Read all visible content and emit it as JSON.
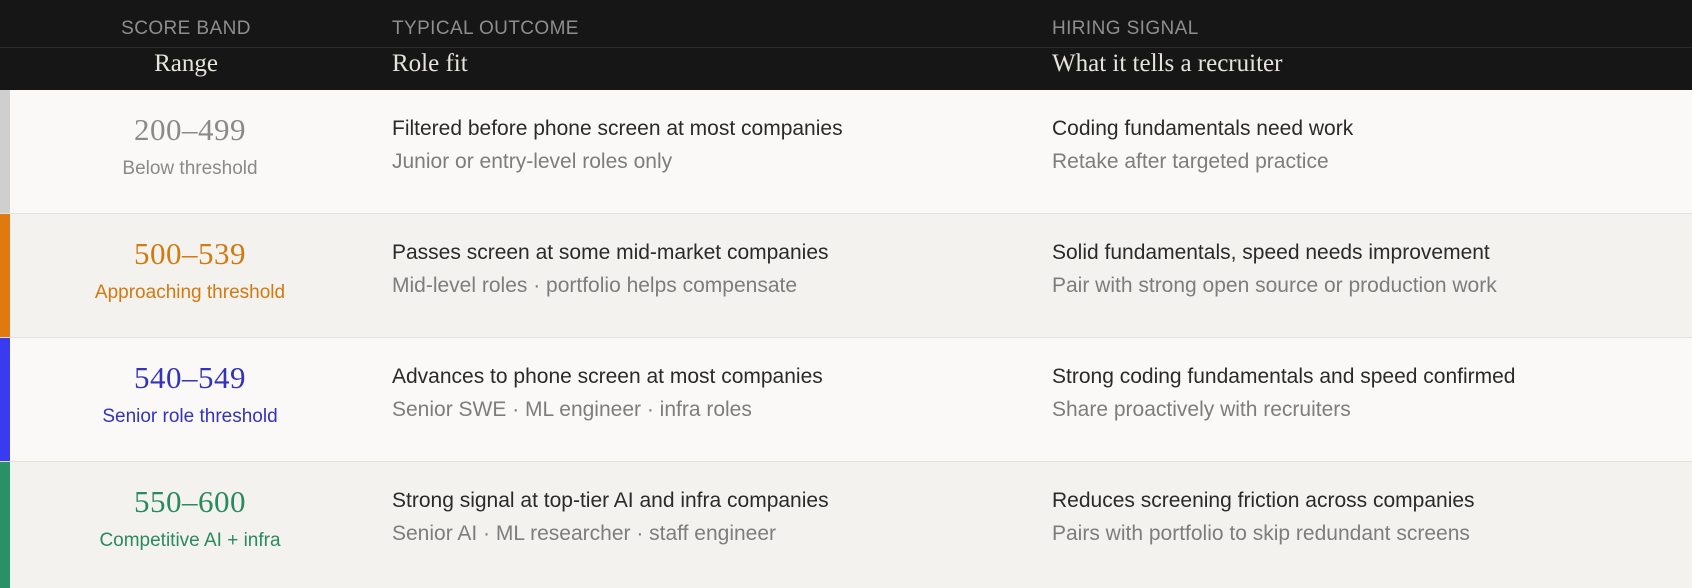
{
  "header": {
    "range": {
      "eyebrow": "SCORE BAND",
      "title": "Range"
    },
    "outcome": {
      "eyebrow": "TYPICAL OUTCOME",
      "title": "Role fit"
    },
    "signal": {
      "eyebrow": "HIRING SIGNAL",
      "title": "What it tells a recruiter"
    }
  },
  "rows": [
    {
      "range": "200–499",
      "band": "Below threshold",
      "color": "#8a8a8a",
      "accent": "#cfcfcf",
      "outcome_primary": "Filtered before phone screen at most companies",
      "outcome_secondary": "Junior or entry-level roles only",
      "signal_primary": "Coding fundamentals need work",
      "signal_secondary": "Retake after targeted practice"
    },
    {
      "range": "500–539",
      "band": "Approaching threshold",
      "color": "#d07a10",
      "accent": "#e07a10",
      "outcome_primary": "Passes screen at some mid-market companies",
      "outcome_secondary": "Mid-level roles · portfolio helps compensate",
      "signal_primary": "Solid fundamentals, speed needs improvement",
      "signal_secondary": "Pair with strong open source or production work"
    },
    {
      "range": "540–549",
      "band": "Senior role threshold",
      "color": "#3333bb",
      "accent": "#3a3af0",
      "outcome_primary": "Advances to phone screen at most companies",
      "outcome_secondary": "Senior SWE · ML engineer · infra roles",
      "signal_primary": "Strong coding fundamentals and speed confirmed",
      "signal_secondary": "Share proactively with recruiters"
    },
    {
      "range": "550–600",
      "band": "Competitive AI + infra",
      "color": "#2a8a5e",
      "accent": "#2a9068",
      "outcome_primary": "Strong signal at top-tier AI and infra companies",
      "outcome_secondary": "Senior AI · ML researcher · staff engineer",
      "signal_primary": "Reduces screening friction across companies",
      "signal_secondary": "Pairs with portfolio to skip redundant screens"
    }
  ]
}
